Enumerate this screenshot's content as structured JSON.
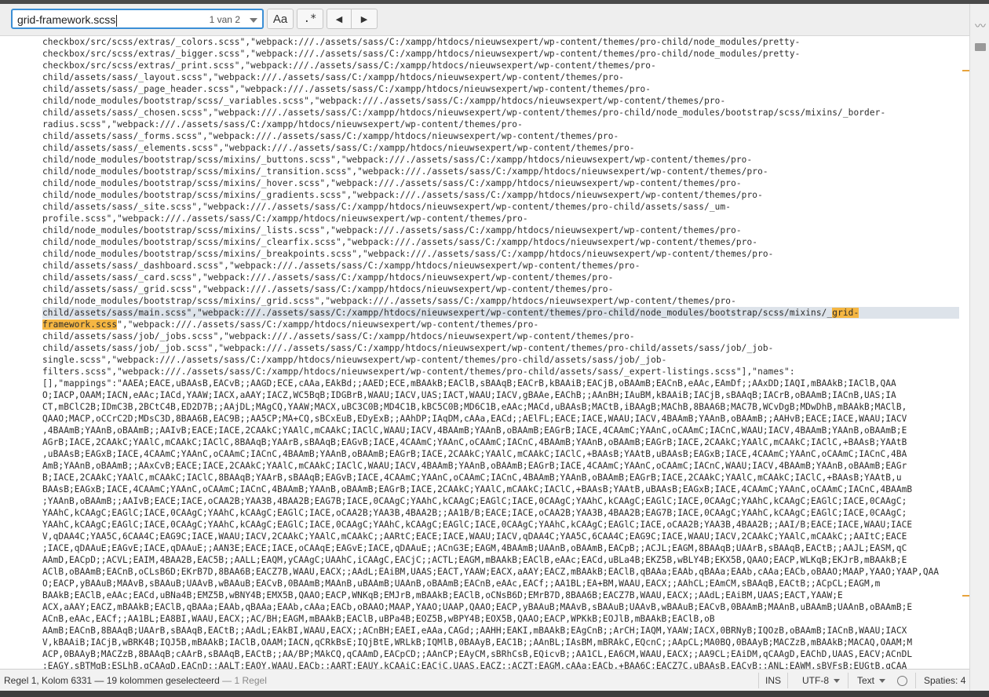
{
  "find": {
    "query": "grid-framework.scss",
    "count": "1 van 2"
  },
  "buttons": {
    "case_label": "Aa",
    "regex_label": ".*",
    "prev_label": "◀",
    "next_label": "▶"
  },
  "code": {
    "lines_before": [
      "checkbox/src/scss/extras/_colors.scss\",\"webpack:///./assets/sass/C:/xampp/htdocs/nieuwsexpert/wp-content/themes/pro-child/node_modules/pretty-",
      "checkbox/src/scss/extras/_bigger.scss\",\"webpack:///./assets/sass/C:/xampp/htdocs/nieuwsexpert/wp-content/themes/pro-child/node_modules/pretty-",
      "checkbox/src/scss/extras/_print.scss\",\"webpack:///./assets/sass/C:/xampp/htdocs/nieuwsexpert/wp-content/themes/pro-",
      "child/assets/sass/_layout.scss\",\"webpack:///./assets/sass/C:/xampp/htdocs/nieuwsexpert/wp-content/themes/pro-",
      "child/assets/sass/_page_header.scss\",\"webpack:///./assets/sass/C:/xampp/htdocs/nieuwsexpert/wp-content/themes/pro-",
      "child/node_modules/bootstrap/scss/_variables.scss\",\"webpack:///./assets/sass/C:/xampp/htdocs/nieuwsexpert/wp-content/themes/pro-",
      "child/assets/sass/_chosen.scss\",\"webpack:///./assets/sass/C:/xampp/htdocs/nieuwsexpert/wp-content/themes/pro-child/node_modules/bootstrap/scss/mixins/_border-",
      "radius.scss\",\"webpack:///./assets/sass/C:/xampp/htdocs/nieuwsexpert/wp-content/themes/pro-",
      "child/assets/sass/_forms.scss\",\"webpack:///./assets/sass/C:/xampp/htdocs/nieuwsexpert/wp-content/themes/pro-",
      "child/assets/sass/_elements.scss\",\"webpack:///./assets/sass/C:/xampp/htdocs/nieuwsexpert/wp-content/themes/pro-",
      "child/node_modules/bootstrap/scss/mixins/_buttons.scss\",\"webpack:///./assets/sass/C:/xampp/htdocs/nieuwsexpert/wp-content/themes/pro-",
      "child/node_modules/bootstrap/scss/mixins/_transition.scss\",\"webpack:///./assets/sass/C:/xampp/htdocs/nieuwsexpert/wp-content/themes/pro-",
      "child/node_modules/bootstrap/scss/mixins/_hover.scss\",\"webpack:///./assets/sass/C:/xampp/htdocs/nieuwsexpert/wp-content/themes/pro-",
      "child/node_modules/bootstrap/scss/mixins/_gradients.scss\",\"webpack:///./assets/sass/C:/xampp/htdocs/nieuwsexpert/wp-content/themes/pro-",
      "child/assets/sass/_site.scss\",\"webpack:///./assets/sass/C:/xampp/htdocs/nieuwsexpert/wp-content/themes/pro-child/assets/sass/_um-",
      "profile.scss\",\"webpack:///./assets/sass/C:/xampp/htdocs/nieuwsexpert/wp-content/themes/pro-",
      "child/node_modules/bootstrap/scss/mixins/_lists.scss\",\"webpack:///./assets/sass/C:/xampp/htdocs/nieuwsexpert/wp-content/themes/pro-",
      "child/node_modules/bootstrap/scss/mixins/_clearfix.scss\",\"webpack:///./assets/sass/C:/xampp/htdocs/nieuwsexpert/wp-content/themes/pro-",
      "child/node_modules/bootstrap/scss/mixins/_breakpoints.scss\",\"webpack:///./assets/sass/C:/xampp/htdocs/nieuwsexpert/wp-content/themes/pro-",
      "child/assets/sass/_dashboard.scss\",\"webpack:///./assets/sass/C:/xampp/htdocs/nieuwsexpert/wp-content/themes/pro-",
      "child/assets/sass/_card.scss\",\"webpack:///./assets/sass/C:/xampp/htdocs/nieuwsexpert/wp-content/themes/pro-",
      "child/assets/sass/_grid.scss\",\"webpack:///./assets/sass/C:/xampp/htdocs/nieuwsexpert/wp-content/themes/pro-",
      "child/node_modules/bootstrap/scss/mixins/_grid.scss\",\"webpack:///./assets/sass/C:/xampp/htdocs/nieuwsexpert/wp-content/themes/pro-"
    ],
    "match_line_prefix": "child/assets/sass/main.scss\",\"webpack:///./assets/sass/C:/xampp/htdocs/nieuwsexpert/wp-content/themes/pro-child/node_modules/bootstrap/scss/mixins/_",
    "match_part1": "grid-",
    "match_part2": "framework.scss",
    "match_line2_suffix": "\",\"webpack:///./assets/sass/C:/xampp/htdocs/nieuwsexpert/wp-content/themes/pro-",
    "lines_after": [
      "child/assets/sass/job/_jobs.scss\",\"webpack:///./assets/sass/C:/xampp/htdocs/nieuwsexpert/wp-content/themes/pro-",
      "child/assets/sass/job/_job.scss\",\"webpack:///./assets/sass/C:/xampp/htdocs/nieuwsexpert/wp-content/themes/pro-child/assets/sass/job/_job-",
      "single.scss\",\"webpack:///./assets/sass/C:/xampp/htdocs/nieuwsexpert/wp-content/themes/pro-child/assets/sass/job/_job-",
      "filters.scss\",\"webpack:///./assets/sass/C:/xampp/htdocs/nieuwsexpert/wp-content/themes/pro-child/assets/sass/_expert-listings.scss\"],\"names\":",
      "[],\"mappings\":\"AAEA;EACE,uBAAsB,EACvB;;AAGD;ECE,cAAa,EAkBd;;AAED;ECE,mBAAkB;EAClB,sBAAqB;EACrB,kBAAiB;EACjB,oBAAmB;EACnB,eAAc,EAmDf;;AAxDD;IAQI,mBAAkB;IAClB,QAA",
      "O;IACP,OAAM;IACN,eAAc;IACd,YAAW;IACX,aAAY;IACZ,WC5BqB;IDGBrB,WAAU;IACV,UAS;IACT,WAAU;IACV,gBAAe,EAChB;;AAnBH;IAuBM,kBAAiB;IACjB,sBAAqB;IACrB,oBAAmB;IACnB,UAS;IA",
      "CT,mBClC2B;IDmC3B,2BCtC4B,ED2D7B;;AAjDL;MAgCQ,YAAW;MACX,uBC3C0B;MD4C1B,kBC5C0B;MD6C1B,eAAc;MACd,uBAAsB;MACtB,iBAAgB;MAChB,8BAA6B;MAC7B,WCvDgB;MDwDhB,mBAAkB;MAClB,",
      "QAAO;MACP,oCCrC2D;MDsC3D,8BAA6B,EAC9B;;AA5CP;MA+CQ,sBCxEuB,EDyExB;;AAhDP;IAqDM,cAAa,EACd;;AElFL;EACE;IACE,WAAU;IACV,4BAAmB;YAAnB,oBAAmB;;AAHvB;EACE;IACE,WAAU;IACV",
      ",4BAAmB;YAAnB,oBAAmB;;AAIvB;EACE;IACE,2CAAkC;YAAlC,mCAAkC;IAClC,WAAU;IACV,4BAAmB;YAAnB,oBAAmB;EAGrB;IACE,4CAAmC;YAAnC,oCAAmC;IACnC,WAAU;IACV,4BAAmB;YAAnB,oBAAmB;E",
      "AGrB;IACE,2CAAkC;YAAlC,mCAAkC;IAClC,8BAAqB;YAArB,sBAAqB;EAGvB;IACE,4CAAmC;YAAnC,oCAAmC;IACnC,4BAAmB;YAAnB,oBAAmB;EAGrB;IACE,2CAAkC;YAAlC,mCAAkC;IAClC,+BAAsB;YAAtB",
      ",uBAAsB;EAGxB;IACE,4CAAmC;YAAnC,oCAAmC;IACnC,4BAAmB;YAAnB,oBAAmB;EAGrB;IACE,2CAAkC;YAAlC,mCAAkC;IAClC,+BAAsB;YAAtB,uBAAsB;EAGxB;IACE,4CAAmC;YAAnC,oCAAmC;IACnC,4BA",
      "AmB;YAAnB,oBAAmB;;AAxCvB;EACE;IACE,2CAAkC;YAAlC,mCAAkC;IAClC,WAAU;IACV,4BAAmB;YAAnB,oBAAmB;EAGrB;IACE,4CAAmC;YAAnC,oCAAmC;IACnC,WAAU;IACV,4BAAmB;YAAnB,oBAAmB;EAGr",
      "B;IACE,2CAAkC;YAAlC,mCAAkC;IAClC,8BAAqB;YAArB,sBAAqB;EAGvB;IACE,4CAAmC;YAAnC,oCAAmC;IACnC,4BAAmB;YAAnB,oBAAmB;EAGrB;IACE,2CAAkC;YAAlC,mCAAkC;IAClC,+BAAsB;YAAtB,u",
      "BAAsB;EAGxB;IACE,4CAAmC;YAAnC,oCAAmC;IACnC,4BAAmB;YAAnB,oBAAmB;EAGrB;IACE,2CAAkC;YAAlC,mCAAkC;IAClC,+BAAsB;YAAtB,uBAAsB;EAGxB;IACE,4CAAmC;YAAnC,oCAAmC;IACnC,4BAAmB",
      ";YAAnB,oBAAmB;;AAIvB;EACE;IACE,oCAA2B;YAA3B,4BAA2B;EAG7B;IACE,0CAAgC;YAAhC,kCAAgC;EAGlC;IACE,0CAAgC;YAAhC,kCAAgC;EAGlC;IACE,0CAAgC;YAAhC,kCAAgC;EAGlC;IACE,0CAAgC;",
      "YAAhC,kCAAgC;EAGlC;IACE,0CAAgC;YAAhC,kCAAgC;EAGlC;IACE,oCAA2B;YAA3B,4BAA2B;;AA1B/B;EACE;IACE,oCAA2B;YAA3B,4BAA2B;EAG7B;IACE,0CAAgC;YAAhC,kCAAgC;EAGlC;IACE,0CAAgC;",
      "YAAhC,kCAAgC;EAGlC;IACE,0CAAgC;YAAhC,kCAAgC;EAGlC;IACE,0CAAgC;YAAhC,kCAAgC;EAGlC;IACE,0CAAgC;YAAhC,kCAAgC;EAGlC;IACE,oCAA2B;YAA3B,4BAA2B;;AAI/B;EACE;IACE,WAAU;IACE",
      "V,qDAA4C;YAA5C,6CAA4C;EAG9C;IACE,WAAU;IACV,2CAAkC;YAAlC,mCAAkC;;AARtC;EACE;IACE,WAAU;IACV,qDAA4C;YAA5C,6CAA4C;EAG9C;IACE,WAAU;IACV,2CAAkC;YAAlC,mCAAkC;;AAItC;EACE",
      ";IACE,qDAAuE;EAGvE;IACE,qDAAuE;;AAN3E;EACE;IACE,oCAAqE;EAGvE;IACE,qDAAuE;;ACnG3E;EAGM,4BAAmB;UAAnB,oBAAmB,EACpB;;ACJL;EAGM,8BAAqB;UAArB,sBAAqB,EACtB;;AAJL;EASM,qC",
      "AAmD,EACpD;;ACVL;EAIM,4BAA2B,EAC5B;;AALL;EAQM,yCAAgC;UAAhC,iCAAgC,EACjC;;ACTL;EAGM,mBAAkB;EAClB,eAAc;EACd,uBLa4B;EKZ5B,wBLY4B;EKX5B,QAAO;EACP,WLKqB;EKJrB,mBAAkB;E",
      "AClB,oBAAmB;EACnB,oCLsB6D;EKrB7D,8BAA6B;EACZ7B,WAAU,EACX;;AAdL;EAiBM,UAAS;EACT,YAAW;EACX,aAAY;EACZ,mBAAkB;EAClB,qBAAa;EAAb,qBAAa;EAAb,cAAa;EACb,oBAAO;MAAP,YAAO;YAAP,QAA",
      "O;EACP,yBAAuB;MAAvB,sBAAuB;UAAvB,wBAAuB;EACvB,0BAAmB;MAAnB,uBAAmB;UAAnB,oBAAmB;EACnB,eAAc,EACf;;AA1BL;EA+BM,WAAU,EACX;;AAhCL;EAmCM,sBAAqB,EACtB;;ACpCL;EAGM,m",
      "BAAkB;EAClB,eAAc;EACd,uBNa4B;EMZ5B,wBNY4B;EMX5B,QAAO;EACP,WNKqB;EMJrB,mBAAkB;EAClB,oCNsB6D;EMrB7D,8BAA6B;EACZ7B,WAAU,EACX;;AAdL;EAiBM,UAAS;EACT,YAAW;E",
      "ACX,aAAY;EACZ,mBAAkB;EAClB,qBAAa;EAAb,qBAAa;EAAb,cAAa;EACb,oBAAO;MAAP,YAAO;UAAP,QAAO;EACP,yBAAuB;MAAvB,sBAAuB;UAAvB,wBAAuB;EACvB,0BAAmB;MAAnB,uBAAmB;UAAnB,oBAAmB;E",
      "ACnB,eAAc,EACf;;AA1BL;EA8BI,WAAU,EACX;;AC/BH;EAGM,mBAAkB;EAClB,uBPa4B;EOZ5B,wBPY4B;EOX5B,QAAO;EACP,WPKkB;EOJlB,mBAAkB;EAClB,oB",
      "AAmB;EACnB,8BAAqB;UAArB,sBAAqB,EACtB;;AAdL;EAkBI,WAAU,EACX;;ACnBH;EAEI,eAAa,CAGd;;AAHH;EAKI,mBAAkB;EAgCnB;;ArCH;IAQM,YAAW;IACX,0BRNyB;IQOzB,oBAAmB;IACnB,WAAU;IACX",
      "V,kBAAiB;IACjB,wBRK4B;IQJ5B,mBAAkB;IAClB,OAAM;IACN,qCRkBsE;IQjBtE,WRLkB;IQMlB,0BAAyB,EAC1B;;AAnBL;IAsBM,mBRAkC,EQcnC;;AApCL;MA0BQ,0BAAyB;MACZzB,mBAAkB;MACAQ,OAAM;M",
      "ACP,0BAAyB;MACZzB,8BAAqB;cAArB,sBAAqB,EACtB;;AA/BP;MAkCQ,qCAAmD,EACpCD;;AAnCP;EAyCM,sBRhCsB,EQicvB;;AA1CL,EA6CM,WAAU,EACX;;AA9CL;EAiDM,qCAAgD,EAChD,UAAS,EACV;ACnDL",
      ";EAGY,sBTMgB;ESLhB,qCAAgD,EACnD;;AALT;EAOY,WAAU,EACb;;AART;EAUY,kCAAiC;EACjC,UAAS,EACZ;;ACZT;EAGM,cAAa;EACb,+BAA6C;EACZ7C,uBAAsB,EACvB;;ANL;EAWM,sBVFsB;EUGtB,qCAA"
    ]
  },
  "status": {
    "position": "Regel 1, Kolom 6331",
    "selection": " — 19 kolommen geselecteerd",
    "lines": " — 1 Regel",
    "ins": "INS",
    "encoding": "UTF-8",
    "syntax": "Text",
    "spaces": "Spaties: 4"
  },
  "colors": {
    "accent": "#3b8fd6",
    "match": "#f5b642",
    "selection": "#dde3ea",
    "marker": "#e8a33c"
  },
  "icons": {
    "prev": "triangle-left-icon",
    "next": "triangle-right-icon",
    "dropdown": "chevron-down-icon",
    "graph": "activity-graph-icon"
  }
}
